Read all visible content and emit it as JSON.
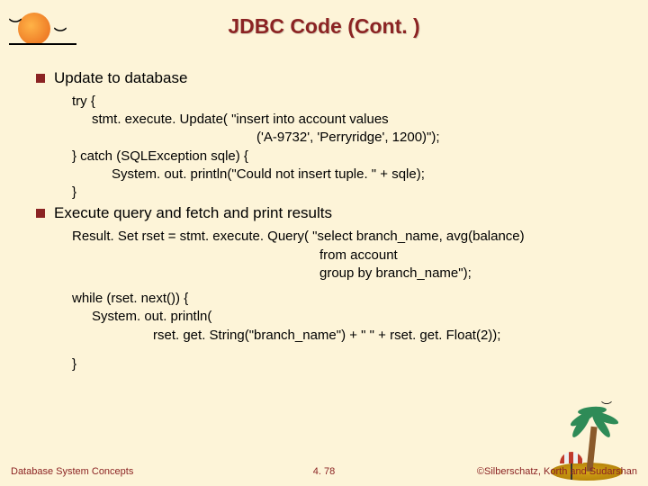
{
  "title": "JDBC Code (Cont. )",
  "bullets": {
    "b1": "Update to database",
    "b2": "Execute query and fetch and print results"
  },
  "code": {
    "c1": "try {",
    "c2": "stmt. execute. Update(  \"insert into account values",
    "c3": "('A-9732', 'Perryridge', 1200)\");",
    "c4": "} catch (SQLException sqle) {",
    "c5": "System. out. println(\"Could not insert tuple. \" + sqle);",
    "c6": "}",
    "c7": "Result. Set rset = stmt. execute. Query( \"select branch_name, avg(balance)",
    "c8": "from account",
    "c9": "group by branch_name\");",
    "c10": "while (rset. next()) {",
    "c11": "System. out. println(",
    "c12": "rset. get. String(\"branch_name\") + \"  \" + rset. get. Float(2));",
    "c13": "}"
  },
  "footer": {
    "left": "Database System Concepts",
    "center": "4. 78",
    "right": "©Silberschatz, Korth and Sudarshan"
  }
}
